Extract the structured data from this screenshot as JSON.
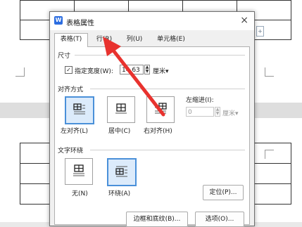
{
  "dialog": {
    "title": "表格属性",
    "app_icon_glyph": "W",
    "close_glyph": "×",
    "tabs": [
      {
        "label": "表格(T)"
      },
      {
        "label": "行(R)"
      },
      {
        "label": "列(U)"
      },
      {
        "label": "单元格(E)"
      }
    ],
    "size_section": {
      "label": "尺寸",
      "specify_width_checked": true,
      "check_glyph": "✓",
      "specify_width_label": "指定宽度(W):",
      "width_value": "14.63",
      "unit_value": "厘米▾"
    },
    "alignment_section": {
      "label": "对齐方式",
      "options": [
        {
          "label": "左对齐(L)"
        },
        {
          "label": "居中(C)"
        },
        {
          "label": "右对齐(H)"
        }
      ],
      "selected": "左对齐(L)",
      "indent_label": "左缩进(I):",
      "indent_value": "0",
      "indent_unit": "厘米▾"
    },
    "wrap_section": {
      "label": "文字环绕",
      "options": [
        {
          "label": "无(N)"
        },
        {
          "label": "环绕(A)"
        }
      ],
      "selected": "环绕(A)",
      "position_button": "定位(P)..."
    },
    "buttons": {
      "borders_shading": "边框和底纹(B)...",
      "options": "选项(O)..."
    }
  },
  "colors": {
    "selection_border": "#4a90d9",
    "selection_fill": "#dcebfb",
    "annotation_arrow": "#e8322e",
    "title_icon": "#2c6de0"
  },
  "icons": {
    "spinner": "spinner-arrows-icon",
    "annotation": "red-arrow-annotation"
  }
}
